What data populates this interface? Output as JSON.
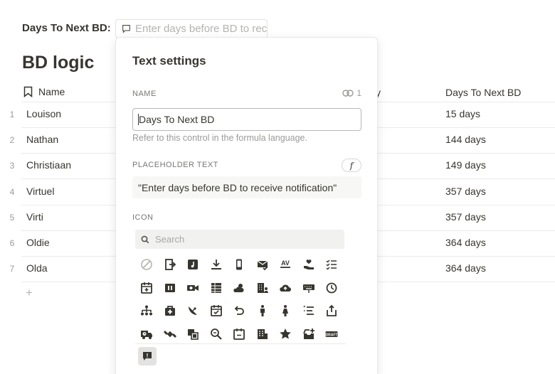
{
  "control": {
    "label": "Days To Next BD:",
    "placeholder": "Enter days before BD to receive notification",
    "icon": "comment-icon"
  },
  "database": {
    "title": "BD logic",
    "columns": {
      "name": "Name",
      "partial": "y",
      "days": "Days To Next BD"
    },
    "rows": [
      {
        "num": "1",
        "name": "Louison",
        "days": "15 days"
      },
      {
        "num": "2",
        "name": "Nathan",
        "days": "144 days"
      },
      {
        "num": "3",
        "name": "Christiaan",
        "days": "149 days"
      },
      {
        "num": "4",
        "name": "Virtuel",
        "days": "357 days"
      },
      {
        "num": "5",
        "name": "Virti",
        "days": "357 days"
      },
      {
        "num": "6",
        "name": "Oldie",
        "days": "364 days"
      },
      {
        "num": "7",
        "name": "Olda",
        "days": "364 days"
      }
    ],
    "add_row": "+"
  },
  "popover": {
    "title": "Text settings",
    "name_section": "NAME",
    "reference_count": "1",
    "name_value": "Days To Next BD",
    "name_help": "Refer to this control in the formula language.",
    "placeholder_section": "PLACEHOLDER TEXT",
    "formula_button": "f",
    "placeholder_value": "\"Enter days before BD to receive notification\"",
    "icon_section": "ICON",
    "search_placeholder": "Search",
    "icons": [
      "no-icon",
      "exit-icon",
      "music-note-icon",
      "download-icon",
      "phone-device-icon",
      "mail-check-icon",
      "av-icon",
      "hand-heart-icon",
      "checklist-icon",
      "calendar-plus-icon",
      "media-pause-icon",
      "video-chat-icon",
      "table-icon",
      "weather-icon",
      "building-user-icon",
      "cloud-upload-icon",
      "keyboard-icon",
      "history-icon",
      "network-icon",
      "first-aid-kit-icon",
      "satellite-dish-icon",
      "calendar-check-icon",
      "undo-icon",
      "man-icon",
      "woman-icon",
      "sort-list-icon",
      "export-icon",
      "truck-clock-icon",
      "satellite-icon",
      "copy-icon",
      "search-zoom-icon",
      "calendar-minus-icon",
      "apartment-icon",
      "star-badge-icon",
      "inbox-plus-icon",
      "draft-icon"
    ],
    "draft_label": "DRAFT",
    "selected_icon": "comment-icon"
  },
  "colors": {
    "text": "#37352f",
    "muted": "#9b9a97",
    "icon": "#37352f",
    "border": "#e3e2e0"
  }
}
